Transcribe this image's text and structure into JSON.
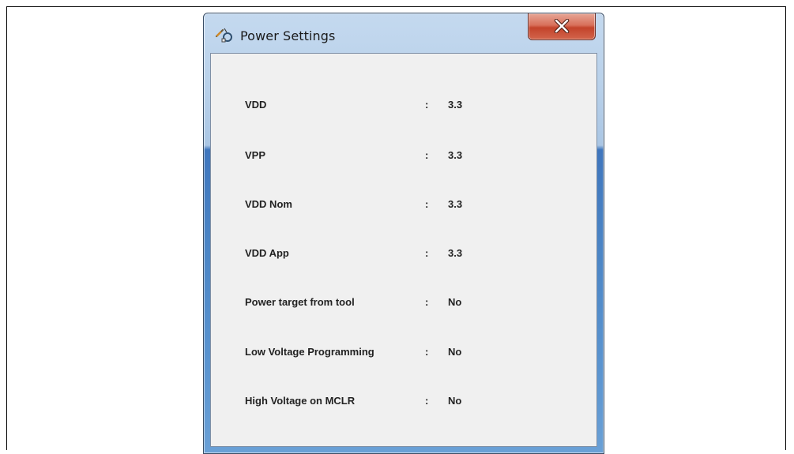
{
  "window": {
    "title": "Power Settings",
    "icon": "power-settings-icon",
    "close_icon": "close-icon"
  },
  "colors": {
    "close_button": "#c8452e",
    "frame_blue": "#4c86c6",
    "client_background": "#f0f0f0"
  },
  "settings": [
    {
      "label": "VDD",
      "separator": ":",
      "value": "3.3"
    },
    {
      "label": "VPP",
      "separator": ":",
      "value": "3.3"
    },
    {
      "label": "VDD Nom",
      "separator": ":",
      "value": "3.3"
    },
    {
      "label": "VDD App",
      "separator": ":",
      "value": "3.3"
    },
    {
      "label": "Power target from tool",
      "separator": ":",
      "value": "No"
    },
    {
      "label": "Low Voltage Programming",
      "separator": ":",
      "value": "No"
    },
    {
      "label": "High Voltage on MCLR",
      "separator": ":",
      "value": "No"
    }
  ]
}
